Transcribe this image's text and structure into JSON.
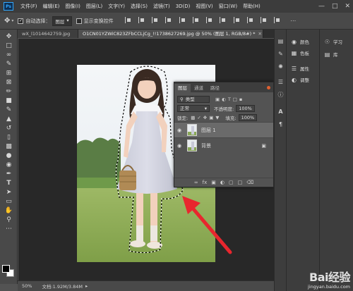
{
  "menu": {
    "logo": "Ps",
    "items": [
      "文件(F)",
      "编辑(E)",
      "图像(I)",
      "图层(L)",
      "文字(Y)",
      "选择(S)",
      "滤镜(T)",
      "3D(D)",
      "视图(V)",
      "窗口(W)",
      "帮助(H)"
    ]
  },
  "options": {
    "auto_select_label": "自动选择：",
    "auto_select_value": "图层",
    "transform_label": "显示变换控件"
  },
  "doc_tabs": [
    {
      "label": "wX_l1014642759.jpg",
      "active": false
    },
    {
      "label": "O1CN01YZWiC823ZFbCCLjCg_!!1738627269.jpg @ 50% (图层 1, RGB/8#) *",
      "active": true
    }
  ],
  "status": {
    "zoom": "50%",
    "doc_info": "文档:1.92M/3.84M"
  },
  "layers_panel": {
    "tabs": [
      "图层",
      "通道",
      "路径"
    ],
    "filter_kind": "类型",
    "blend_mode": "正常",
    "opacity_label": "不透明度:",
    "opacity_value": "100%",
    "lock_label": "锁定:",
    "fill_label": "填充:",
    "fill_value": "100%",
    "layers": [
      {
        "name": "图层 1",
        "selected": true
      },
      {
        "name": "背景",
        "selected": false
      }
    ],
    "bottom_icons": [
      "link-icon",
      "fx-icon",
      "mask-icon",
      "adjustment-icon",
      "group-icon",
      "new-layer-icon",
      "trash-icon"
    ]
  },
  "dock": {
    "panels": [
      {
        "label": "颜色",
        "icon": "color-icon"
      },
      {
        "label": "色板",
        "icon": "swatches-icon"
      },
      {
        "label": "属性",
        "icon": "properties-icon"
      },
      {
        "label": "调整",
        "icon": "adjustments-icon"
      }
    ],
    "learn": [
      {
        "label": "学习",
        "icon": "learn-icon"
      },
      {
        "label": "库",
        "icon": "libraries-icon"
      }
    ]
  },
  "watermark": {
    "logo": "Bai经验",
    "url": "jingyan.baidu.com"
  },
  "colors": {
    "menubar": "#3c3c3c",
    "panel": "#535353",
    "canvas_bg": "#282828",
    "annotation_arrow": "#e8262e"
  }
}
